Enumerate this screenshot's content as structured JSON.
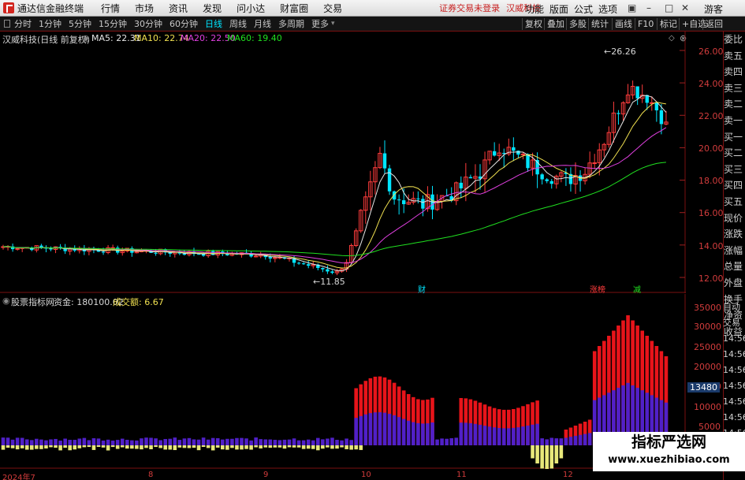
{
  "menubar": {
    "app_title": "通达信金融终端",
    "items": [
      "行情",
      "市场",
      "资讯",
      "发现",
      "问小达",
      "财富圈",
      "交易"
    ],
    "status": "证券交易未登录",
    "stock_name": "汉威科技",
    "right_items": [
      "功能",
      "版面",
      "公式",
      "选项"
    ],
    "user": "游客"
  },
  "toolbar": {
    "periods": [
      "分时",
      "1分钟",
      "5分钟",
      "15分钟",
      "30分钟",
      "60分钟",
      "日线",
      "周线",
      "月线",
      "多周期",
      "更多"
    ],
    "active_period": "日线",
    "right_buttons": [
      "复权",
      "叠加",
      "多股",
      "统计",
      "画线",
      "F10",
      "标记",
      "+自选",
      "返回"
    ]
  },
  "price_legend": {
    "title": "汉威科技(日线 前复权)",
    "ma5": "MA5: 22.31",
    "ma10": "MA10: 22.74",
    "ma20": "MA20: 22.50",
    "ma60": "MA60: 19.40"
  },
  "vol_legend": {
    "title": "股票指标网",
    "fund": "资金: 180100.02",
    "turnover": "成交额: 6.67"
  },
  "price_axis": [
    "26.00",
    "24.00",
    "22.00",
    "20.00",
    "18.00",
    "16.00",
    "14.00",
    "12.00"
  ],
  "vol_axis": [
    "35000",
    "30000",
    "25000",
    "20000",
    "15000",
    "10000",
    "5000"
  ],
  "vol_badge": "13480",
  "annotations": {
    "high": "26.26",
    "low": "11.85",
    "mark_cai": "财",
    "mark_zt": "涨榜",
    "mark_jian": "减"
  },
  "dates": [
    "2024年7",
    "8",
    "9",
    "10",
    "11",
    "12"
  ],
  "right_panel": [
    "委比",
    "卖五",
    "卖四",
    "卖三",
    "卖二",
    "卖一",
    "买一",
    "买二",
    "买三",
    "买四",
    "买五",
    "现价",
    "涨跌",
    "涨幅",
    "总量",
    "外盘",
    "换手",
    "净资",
    "收益"
  ],
  "right_panel2": [
    "自动",
    "交易",
    "14:56",
    "14:56",
    "14:56",
    "14:56",
    "14:56",
    "14:56",
    "14:56",
    "14:56",
    "14:56"
  ],
  "watermark": {
    "line1": "指标严选网",
    "line2": "www.xuezhibiao.com"
  },
  "colors": {
    "up": "#ff3c3c",
    "down": "#00e5ff",
    "ma5": "#e6e6e6",
    "ma10": "#f0e050",
    "ma20": "#e040e0",
    "ma60": "#20e020",
    "vol_red": "#e8141a",
    "vol_purple": "#5020c8"
  }
}
